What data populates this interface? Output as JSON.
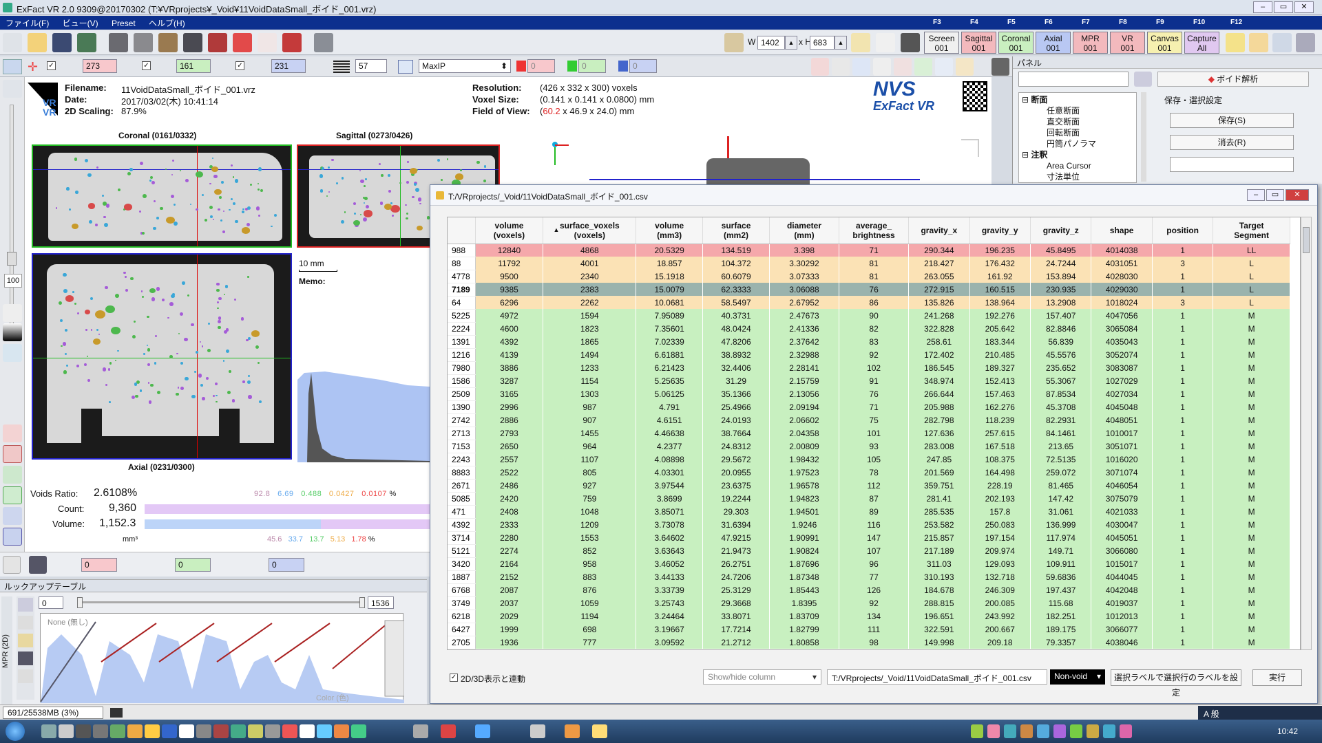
{
  "app": {
    "title": "ExFact VR 2.0 9309@20170302 (T:¥VRprojects¥_Void¥11VoidDataSmall_ボイド_001.vrz)"
  },
  "menu": [
    "ファイル(F)",
    "ビュー(V)",
    "Preset",
    "ヘルプ(H)"
  ],
  "fkeys": [
    "F3",
    "F4",
    "F5",
    "F6",
    "F7",
    "F8",
    "F9",
    "F10",
    "F12"
  ],
  "toolbar": {
    "w_label": "W",
    "w_value": "1402",
    "h_label": "x H",
    "h_value": "683",
    "views": [
      {
        "l1": "Screen",
        "l2": "001",
        "bg": "#f0f0f0"
      },
      {
        "l1": "Sagittal",
        "l2": "001",
        "bg": "#f3b9bd"
      },
      {
        "l1": "Coronal",
        "l2": "001",
        "bg": "#c9efc0"
      },
      {
        "l1": "Axial",
        "l2": "001",
        "bg": "#b9c8f3"
      },
      {
        "l1": "MPR",
        "l2": "001",
        "bg": "#f3b9bd"
      },
      {
        "l1": "VR",
        "l2": "001",
        "bg": "#f3b9bd"
      },
      {
        "l1": "Canvas",
        "l2": "001",
        "bg": "#f6f0b0"
      },
      {
        "l1": "Capture",
        "l2": "All",
        "bg": "#e0c8f0"
      }
    ]
  },
  "toolbar2": {
    "red_val": "273",
    "green_val": "161",
    "blue_val": "231",
    "thick": "57",
    "mode": "MaxIP",
    "a_val": "0",
    "b_val": "0",
    "c_val": "0"
  },
  "info": {
    "filename_label": "Filename:",
    "filename": "11VoidDataSmall_ボイド_001.vrz",
    "date_label": "Date:",
    "date": "2017/03/02(木) 10:41:14",
    "scaling_label": "2D Scaling:",
    "scaling": "87.9%",
    "res_label": "Resolution:",
    "res": "(426 x 332 x 300) voxels",
    "voxel_label": "Voxel Size:",
    "voxel": "(0.141 x 0.141 x 0.0800) mm",
    "fov_label": "Field of View:",
    "fov_a": "60.2",
    "fov_b": " x 46.9 x 24.0",
    "fov_c": ") mm",
    "fov_open": "(",
    "brand": "NVS ExFact VR"
  },
  "views": {
    "coronal": "Coronal (0161/0332)",
    "sagittal": "Sagittal (0273/0426)",
    "axial": "Axial (0231/0300)",
    "scale": "10 mm",
    "memo": "Memo:"
  },
  "stats": {
    "ratio_label": "Voids Ratio:",
    "ratio": "2.6108%",
    "count_label": "Count:",
    "count": "9,360",
    "volume_label": "Volume:",
    "volume": "1,152.3",
    "unit": "mm³",
    "pct1": [
      "92.8",
      "6.69",
      "0.488",
      "0.0427",
      "0.0107",
      "%"
    ],
    "pct2": [
      "45.6",
      "33.7",
      "13.7",
      "5.13",
      "1.78",
      "%"
    ]
  },
  "right_panel": {
    "title": "パネル",
    "analyze_btn": "ボイド解析",
    "tree": [
      "断面",
      "任意断面",
      "直交断面",
      "回転断面",
      "円筒パノラマ",
      "注釈",
      "Area Cursor",
      "寸法単位"
    ],
    "save_group": "保存・選択設定",
    "save_btn": "保存(S)",
    "delete_btn": "消去(R)"
  },
  "csv": {
    "title": "T:/VRprojects/_Void/11VoidDataSmall_ボイド_001.csv",
    "columns": [
      {
        "l1": "volume",
        "l2": "(voxels)"
      },
      {
        "l1": "surface_voxels",
        "l2": "(voxels)"
      },
      {
        "l1": "volume",
        "l2": "(mm3)"
      },
      {
        "l1": "surface",
        "l2": "(mm2)"
      },
      {
        "l1": "diameter",
        "l2": "(mm)"
      },
      {
        "l1": "average_",
        "l2": "brightness"
      },
      {
        "l1": "gravity_x",
        "l2": ""
      },
      {
        "l1": "gravity_y",
        "l2": ""
      },
      {
        "l1": "gravity_z",
        "l2": ""
      },
      {
        "l1": "shape",
        "l2": ""
      },
      {
        "l1": "position",
        "l2": ""
      },
      {
        "l1": "Target",
        "l2": "Segment"
      }
    ],
    "rows": [
      [
        "988",
        "12840",
        "4868",
        "20.5329",
        "134.519",
        "3.398",
        "71",
        "290.344",
        "196.235",
        "45.8495",
        "4014038",
        "1",
        "LL"
      ],
      [
        "88",
        "11792",
        "4001",
        "18.857",
        "104.372",
        "3.30292",
        "81",
        "218.427",
        "176.432",
        "24.7244",
        "4031051",
        "3",
        "L"
      ],
      [
        "4778",
        "9500",
        "2340",
        "15.1918",
        "60.6079",
        "3.07333",
        "81",
        "263.055",
        "161.92",
        "153.894",
        "4028030",
        "1",
        "L"
      ],
      [
        "7189",
        "9385",
        "2383",
        "15.0079",
        "62.3333",
        "3.06088",
        "76",
        "272.915",
        "160.515",
        "230.935",
        "4029030",
        "1",
        "L"
      ],
      [
        "64",
        "6296",
        "2262",
        "10.0681",
        "58.5497",
        "2.67952",
        "86",
        "135.826",
        "138.964",
        "13.2908",
        "1018024",
        "3",
        "L"
      ],
      [
        "5225",
        "4972",
        "1594",
        "7.95089",
        "40.3731",
        "2.47673",
        "90",
        "241.268",
        "192.276",
        "157.407",
        "4047056",
        "1",
        "M"
      ],
      [
        "2224",
        "4600",
        "1823",
        "7.35601",
        "48.0424",
        "2.41336",
        "82",
        "322.828",
        "205.642",
        "82.8846",
        "3065084",
        "1",
        "M"
      ],
      [
        "1391",
        "4392",
        "1865",
        "7.02339",
        "47.8206",
        "2.37642",
        "83",
        "258.61",
        "183.344",
        "56.839",
        "4035043",
        "1",
        "M"
      ],
      [
        "1216",
        "4139",
        "1494",
        "6.61881",
        "38.8932",
        "2.32988",
        "92",
        "172.402",
        "210.485",
        "45.5576",
        "3052074",
        "1",
        "M"
      ],
      [
        "7980",
        "3886",
        "1233",
        "6.21423",
        "32.4406",
        "2.28141",
        "102",
        "186.545",
        "189.327",
        "235.652",
        "3083087",
        "1",
        "M"
      ],
      [
        "1586",
        "3287",
        "1154",
        "5.25635",
        "31.29",
        "2.15759",
        "91",
        "348.974",
        "152.413",
        "55.3067",
        "1027029",
        "1",
        "M"
      ],
      [
        "2509",
        "3165",
        "1303",
        "5.06125",
        "35.1366",
        "2.13056",
        "76",
        "266.644",
        "157.463",
        "87.8534",
        "4027034",
        "1",
        "M"
      ],
      [
        "1390",
        "2996",
        "987",
        "4.791",
        "25.4966",
        "2.09194",
        "71",
        "205.988",
        "162.276",
        "45.3708",
        "4045048",
        "1",
        "M"
      ],
      [
        "2742",
        "2886",
        "907",
        "4.6151",
        "24.0193",
        "2.06602",
        "75",
        "282.798",
        "118.239",
        "82.2931",
        "4048051",
        "1",
        "M"
      ],
      [
        "2713",
        "2793",
        "1455",
        "4.46638",
        "38.7664",
        "2.04358",
        "101",
        "127.636",
        "257.615",
        "84.1461",
        "1010017",
        "1",
        "M"
      ],
      [
        "7153",
        "2650",
        "964",
        "4.2377",
        "24.8312",
        "2.00809",
        "93",
        "283.008",
        "167.518",
        "213.65",
        "3051071",
        "1",
        "M"
      ],
      [
        "2243",
        "2557",
        "1107",
        "4.08898",
        "29.5672",
        "1.98432",
        "105",
        "247.85",
        "108.375",
        "72.5135",
        "1016020",
        "1",
        "M"
      ],
      [
        "8883",
        "2522",
        "805",
        "4.03301",
        "20.0955",
        "1.97523",
        "78",
        "201.569",
        "164.498",
        "259.072",
        "3071074",
        "1",
        "M"
      ],
      [
        "2671",
        "2486",
        "927",
        "3.97544",
        "23.6375",
        "1.96578",
        "112",
        "359.751",
        "228.19",
        "81.465",
        "4046054",
        "1",
        "M"
      ],
      [
        "5085",
        "2420",
        "759",
        "3.8699",
        "19.2244",
        "1.94823",
        "87",
        "281.41",
        "202.193",
        "147.42",
        "3075079",
        "1",
        "M"
      ],
      [
        "471",
        "2408",
        "1048",
        "3.85071",
        "29.303",
        "1.94501",
        "89",
        "285.535",
        "157.8",
        "31.061",
        "4021033",
        "1",
        "M"
      ],
      [
        "4392",
        "2333",
        "1209",
        "3.73078",
        "31.6394",
        "1.9246",
        "116",
        "253.582",
        "250.083",
        "136.999",
        "4030047",
        "1",
        "M"
      ],
      [
        "3714",
        "2280",
        "1553",
        "3.64602",
        "47.9215",
        "1.90991",
        "147",
        "215.857",
        "197.154",
        "117.974",
        "4045051",
        "1",
        "M"
      ],
      [
        "5121",
        "2274",
        "852",
        "3.63643",
        "21.9473",
        "1.90824",
        "107",
        "217.189",
        "209.974",
        "149.71",
        "3066080",
        "1",
        "M"
      ],
      [
        "3420",
        "2164",
        "958",
        "3.46052",
        "26.2751",
        "1.87696",
        "96",
        "311.03",
        "129.093",
        "109.911",
        "1015017",
        "1",
        "M"
      ],
      [
        "1887",
        "2152",
        "883",
        "3.44133",
        "24.7206",
        "1.87348",
        "77",
        "310.193",
        "132.718",
        "59.6836",
        "4044045",
        "1",
        "M"
      ],
      [
        "6768",
        "2087",
        "876",
        "3.33739",
        "25.3129",
        "1.85443",
        "126",
        "184.678",
        "246.309",
        "197.437",
        "4042048",
        "1",
        "M"
      ],
      [
        "3749",
        "2037",
        "1059",
        "3.25743",
        "29.3668",
        "1.8395",
        "92",
        "288.815",
        "200.085",
        "115.68",
        "4019037",
        "1",
        "M"
      ],
      [
        "6218",
        "2029",
        "1194",
        "3.24464",
        "33.8071",
        "1.83709",
        "134",
        "196.651",
        "243.992",
        "182.251",
        "1012013",
        "1",
        "M"
      ],
      [
        "6427",
        "1999",
        "698",
        "3.19667",
        "17.7214",
        "1.82799",
        "111",
        "322.591",
        "200.667",
        "189.175",
        "3066077",
        "1",
        "M"
      ],
      [
        "2705",
        "1936",
        "777",
        "3.09592",
        "21.2712",
        "1.80858",
        "98",
        "149.998",
        "209.18",
        "79.3357",
        "4038046",
        "1",
        "M"
      ]
    ],
    "selected_row": 3,
    "sync_label": "2D/3D表示と連動",
    "showhide": "Show/hide column",
    "file_select": "T:/VRprojects/_Void/11VoidDataSmall_ボイド_001.csv",
    "filter": "Non-void",
    "label_btn": "選択ラベルで選択行のラベルを設定",
    "run_btn": "実行"
  },
  "lut": {
    "title": "ルックアップテーブル",
    "min": "0",
    "max": "1536",
    "none": "None (無し)",
    "color": "Color (色)",
    "side": "MPR (2D)"
  },
  "status": {
    "memory": "691/25538MB (3%)",
    "clock": "10:42",
    "ime": "A 般"
  }
}
